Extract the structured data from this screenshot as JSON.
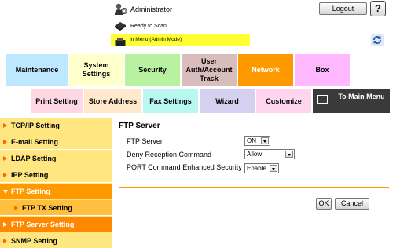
{
  "header": {
    "user_label": "Administrator",
    "logout_label": "Logout",
    "help_label": "?",
    "status_text": "Ready to Scan",
    "mode_text": "In Menu (Admin Mode)"
  },
  "tabs": [
    {
      "label": "Maintenance"
    },
    {
      "label": "System Settings"
    },
    {
      "label": "Security"
    },
    {
      "label": "User Auth/Account Track"
    },
    {
      "label": "Network"
    },
    {
      "label": "Box"
    }
  ],
  "subtabs": [
    {
      "label": "Print Setting"
    },
    {
      "label": "Store Address"
    },
    {
      "label": "Fax Settings"
    },
    {
      "label": "Wizard"
    },
    {
      "label": "Customize"
    },
    {
      "label": "To Main Menu"
    }
  ],
  "nav": [
    {
      "label": "TCP/IP Setting"
    },
    {
      "label": "E-mail Setting"
    },
    {
      "label": "LDAP Setting"
    },
    {
      "label": "IPP Setting"
    },
    {
      "label": "FTP Setting"
    },
    {
      "label": "FTP TX Setting"
    },
    {
      "label": "FTP Server Setting"
    },
    {
      "label": "SNMP Setting"
    }
  ],
  "content": {
    "title": "FTP Server",
    "fields": [
      {
        "label": "FTP Server",
        "value": "ON"
      },
      {
        "label": "Deny Reception Command",
        "value": "Allow"
      },
      {
        "label": "PORT Command Enhanced Security",
        "value": "Enable"
      }
    ],
    "ok_label": "OK",
    "cancel_label": "Cancel"
  },
  "colors": {
    "accent": "#ff9900",
    "mode_bar": "#ffff33",
    "nav_bg": "#ffe680"
  }
}
